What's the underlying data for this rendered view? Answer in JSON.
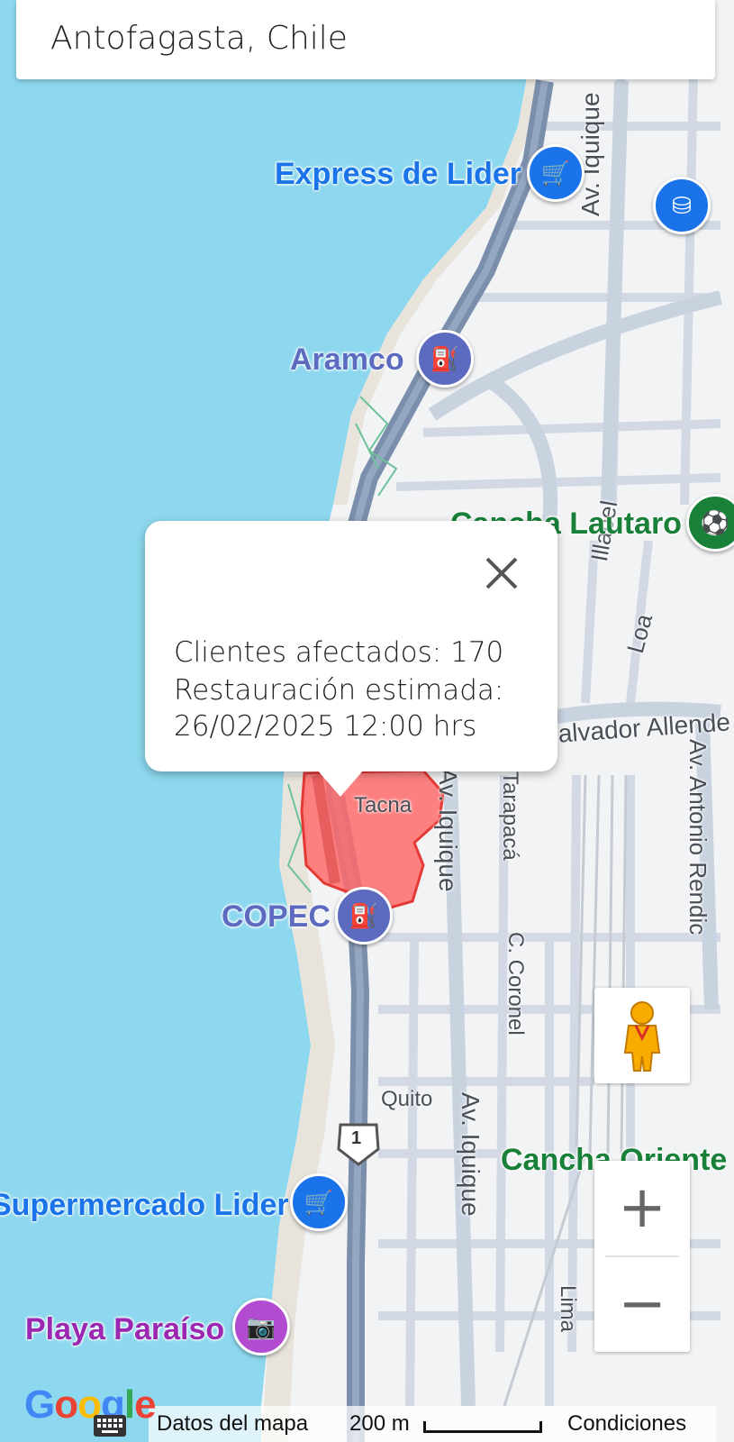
{
  "search": {
    "value": "Antofagasta, Chile"
  },
  "pois": [
    {
      "label": "Express de Lider",
      "category": "shopping-cart-icon",
      "color": "#1a73e8"
    },
    {
      "label": "Aramco",
      "category": "gas-station-icon",
      "color": "#5c6bc0"
    },
    {
      "label": "Cancha Lautaro",
      "category": "sports-icon",
      "color": "#188038"
    },
    {
      "label": "COPEC",
      "category": "gas-station-icon",
      "color": "#5c6bc0"
    },
    {
      "label": "Supermercado Lider",
      "category": "shopping-cart-icon",
      "color": "#1a73e8"
    },
    {
      "label": "Playa Paraíso",
      "category": "camera-icon",
      "color": "#9c27b0"
    },
    {
      "label": "Cancha Oriente",
      "category": "sports-icon",
      "color": "#188038"
    }
  ],
  "streets": [
    "Av. Iquique",
    "Illapel",
    "Loa",
    "Salvador Allende",
    "Av. Antonio Rendic",
    "Tacna",
    "Tarapacá",
    "C. Coronel",
    "Quito",
    "Av. Iquique",
    "Lima"
  ],
  "highway_shield": "1",
  "outage_area": {
    "fill": "#ff6b6b",
    "stroke": "#e53935"
  },
  "popup": {
    "line1": "Clientes afectados: 170",
    "line2": "Restauración estimada:",
    "line3": "26/02/2025 12:00 hrs"
  },
  "controls": {
    "zoom_in": "+",
    "zoom_out": "−"
  },
  "footer": {
    "brand": "Google",
    "map_data": "Datos del mapa",
    "scale": "200 m",
    "terms": "Condiciones"
  },
  "colors": {
    "water": "#8dd8ee",
    "land": "#f2f3f5",
    "road": "#c9d3e0",
    "highway": "#7b8fac",
    "park": "#6cc39a"
  }
}
